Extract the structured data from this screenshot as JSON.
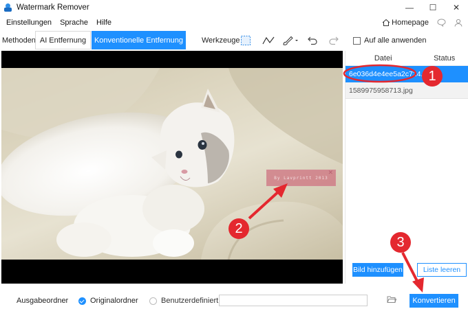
{
  "window": {
    "title": "Watermark Remover",
    "controls": [
      "—",
      "☐",
      "✕"
    ]
  },
  "menu": {
    "items": [
      "Einstellungen",
      "Sprache",
      "Hilfe"
    ],
    "homepage": "Homepage"
  },
  "toolbar": {
    "methods_label": "Methoden:",
    "ai_label": "AI Entfernung",
    "conventional_label": "Konventionelle Entfernung",
    "tools_label": "Werkzeuge",
    "apply_all_label": "Auf alle anwenden",
    "apply_all_checked": false
  },
  "preview": {
    "watermark_text": "By Lavprintt 2013"
  },
  "file_list": {
    "col_file": "Datei",
    "col_status": "Status",
    "files": [
      {
        "name": "6e036d4e4ee5a2c724...",
        "status": "",
        "selected": true
      },
      {
        "name": "1589975958713.jpg",
        "status": "",
        "selected": false
      }
    ],
    "add_label": "Bild hinzufügen",
    "clear_label": "Liste leeren"
  },
  "output": {
    "label": "Ausgabeordner",
    "original_label": "Originalordner",
    "custom_label": "Benutzerdefiniert",
    "selected": "original",
    "path_value": "",
    "convert_label": "Konvertieren"
  },
  "annotations": {
    "markers": [
      "1",
      "2",
      "3"
    ]
  },
  "colors": {
    "accent": "#1e90ff",
    "annotation": "#e4282f"
  }
}
